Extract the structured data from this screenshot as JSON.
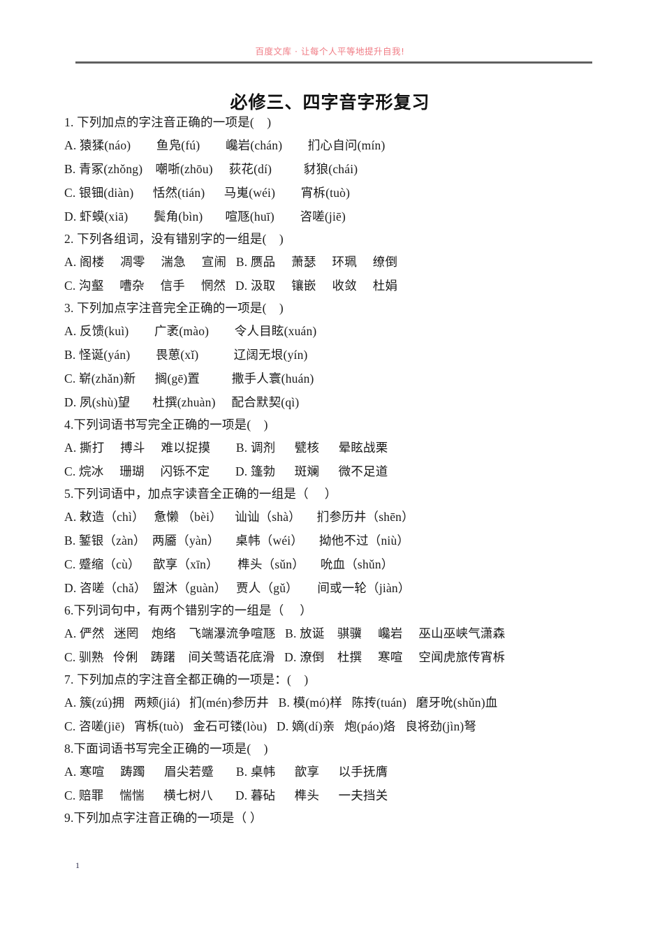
{
  "header": {
    "watermark": "百度文库 · 让每个人平等地提升自我!",
    "watermark_color": "#f07c85",
    "rule_color": "#606060"
  },
  "title": "必修三、四字音字形复习",
  "footer": {
    "page_number": "1"
  },
  "questions": [
    {
      "number": "1.",
      "stem": "1. 下列加点的字注音正确的一项是(    )",
      "lines": [
        "A. 猿猱(náo)        鱼凫(fú)        巉岩(chán)        扪心自问(mín)",
        "B. 青冢(zhǒng)    嘲哳(zhōu)     荻花(dí)          豺狼(chái)",
        "C. 银钿(diàn)      恬然(tián)      马嵬(wéi)        宵柝(tuò)",
        "D. 虾蟆(xiā)        鬓角(bìn)       喧豗(huī)        咨嗟(jiē)"
      ]
    },
    {
      "number": "2.",
      "stem": "2. 下列各组词，没有错别字的一组是(    )",
      "lines": [
        "A. 阁楼     凋零     湍急     宣闹   B. 赝品     萧瑟     环珮     缭倒",
        "C. 沟壑     嘈杂     信手     惘然   D. 汲取     镶嵌     收敛     杜娟"
      ]
    },
    {
      "number": "3.",
      "stem": "3. 下列加点字注音完全正确的一项是(    )",
      "lines": [
        "A. 反馈(kuì)        广袤(mào)        令人目眩(xuán)",
        "B. 怪诞(yán)        畏葸(xǐ)           辽阔无垠(yín)",
        "C. 崭(zhǎn)新      搁(gē)置          撒手人寰(huán)",
        "D. 夙(shù)望       杜撰(zhuàn)     配合默契(qì)"
      ]
    },
    {
      "number": "4.",
      "stem": "4.下列词语书写完全正确的一项是(    )",
      "lines": [
        "A. 撕打     搏斗     难以捉摸        B. 调剂      甓核      晕眩战栗",
        "C. 烷冰     珊瑚     闪铄不定        D. 篷勃      斑斓      微不足道"
      ]
    },
    {
      "number": "5.",
      "stem": "5.下列词语中，加点字读音全正确的一组是（     ）",
      "lines": [
        "A. 敕造（chì）   惫懒 （bèi）    讪讪（shà）     扪参历井（shēn）",
        "B. 錾银（zàn）  两靥（yàn）     桌帏（wéi）     拗他不过（niù）",
        "C. 蹙缩（cù）    歆享（xīn）      榫头（sǔn）     吮血（shǔn）",
        "D. 咨嗟（chǎ）  盥沐（guàn）   贾人（gǔ）      间或一轮（jiàn）"
      ]
    },
    {
      "number": "6.",
      "stem": "6.下列词句中，有两个错别字的一组是（     ）",
      "lines": [
        "A. 俨然   迷罔    炮络    飞端瀑流争喧豗   B. 放诞    骐骥     巉岩     巫山巫峡气潇森",
        "C. 驯熟   伶俐    踌躇    间关莺语花底滑   D. 潦倒    杜撰     寒喧     空闻虎旅传宵柝"
      ]
    },
    {
      "number": "7.",
      "stem": "7. 下列加点的字注音全都正确的一项是：(    )",
      "lines": [
        "A. 簇(zú)拥   两颊(jiá)   扪(mén)参历井   B. 模(mó)样   陈抟(tuán)   磨牙吮(shǔn)血",
        "C. 咨嗟(jiē)   宵柝(tuò)   金石可镂(lòu)   D. 嫡(dí)亲   炮(páo)烙   良将劲(jìn)弩"
      ]
    },
    {
      "number": "8.",
      "stem": "8.下面词语书写完全正确的一项是(    )",
      "lines": [
        "A. 寒喧     踌躅      眉尖若蹙       B. 桌帏      歆享      以手抚膺",
        "C. 赔罪     惴惴      横七树八       D. 暮砧      榫头      一夫挡关"
      ]
    },
    {
      "number": "9.",
      "stem": "9.下列加点字注音正确的一项是（ ）",
      "lines": []
    }
  ]
}
